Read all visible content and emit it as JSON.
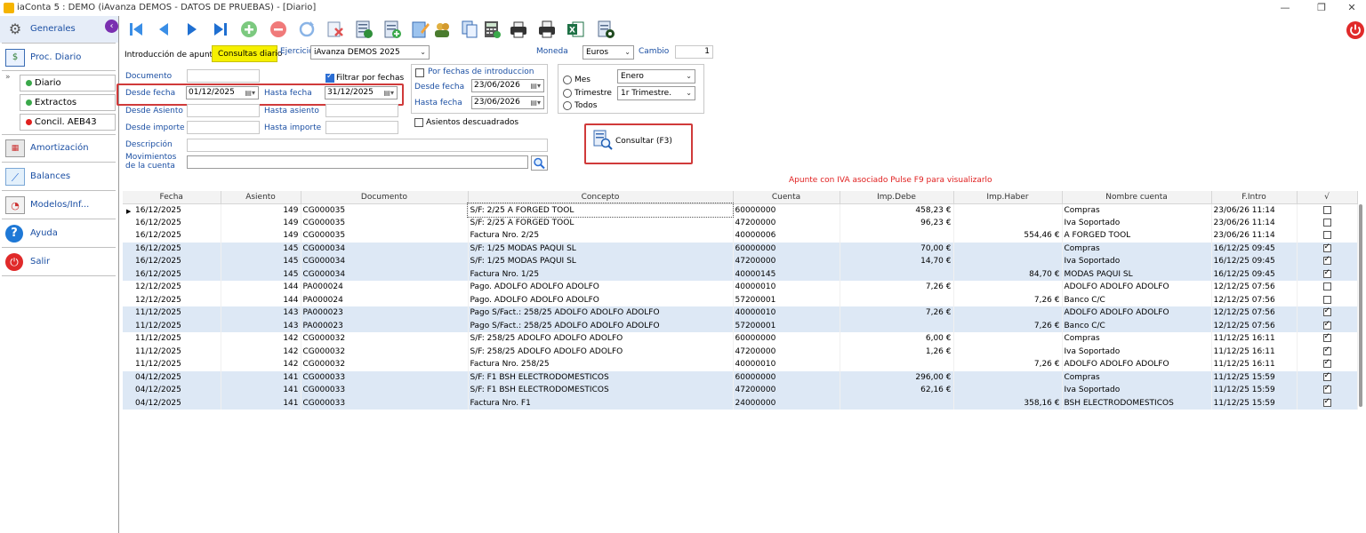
{
  "window": {
    "title": "iaConta 5 : DEMO (iAvanza DEMOS - DATOS DE PRUEBAS) - [Diario]"
  },
  "sidebar": {
    "items": [
      {
        "label": "Generales",
        "icon": "gear-icon"
      },
      {
        "label": "Proc. Diario",
        "icon": "journal-icon"
      },
      {
        "label": "Amortización",
        "icon": "calculator-icon"
      },
      {
        "label": "Balances",
        "icon": "chart-icon"
      },
      {
        "label": "Modelos/Inf...",
        "icon": "report-icon"
      },
      {
        "label": "Ayuda",
        "icon": "help-icon"
      },
      {
        "label": "Salir",
        "icon": "power-icon"
      }
    ],
    "subitems": [
      {
        "label": "Diario",
        "color": "#3aa84a"
      },
      {
        "label": "Extractos",
        "color": "#3aa84a"
      },
      {
        "label": "Concil. AEB43",
        "color": "#e0201e"
      }
    ]
  },
  "tabs": {
    "tab1": "Introducción de apuntes",
    "tab2": "Consultas diario"
  },
  "filters": {
    "ejercicio_label": "Ejercicio",
    "ejercicio_value": "iAvanza DEMOS 2025",
    "moneda_label": "Moneda",
    "moneda_value": "Euros",
    "cambio_label": "Cambio",
    "cambio_value": "1",
    "documento_label": "Documento",
    "desde_fecha_label": "Desde fecha",
    "desde_fecha_value": "01/12/2025",
    "hasta_fecha_label": "Hasta fecha",
    "hasta_fecha_value": "31/12/2025",
    "filtrar_label": "Filtrar por fechas",
    "desde_asiento_label": "Desde Asiento",
    "hasta_asiento_label": "Hasta asiento",
    "desde_importe_label": "Desde importe",
    "hasta_importe_label": "Hasta importe",
    "descripcion_label": "Descripción",
    "movimientos_label1": "Movimientos",
    "movimientos_label2": "de la cuenta",
    "por_fechas_label": "Por fechas de introduccion",
    "intro_desde_label": "Desde fecha",
    "intro_desde_value": "23/06/2026",
    "intro_hasta_label": "Hasta fecha",
    "intro_hasta_value": "23/06/2026",
    "descuadrados_label": "Asientos descuadrados",
    "mes_label": "Mes",
    "mes_value": "Enero",
    "trimestre_label": "Trimestre",
    "trimestre_value": "1r Trimestre.",
    "todos_label": "Todos",
    "consultar_label": "Consultar (F3)"
  },
  "notice": "Apunte con IVA asociado Pulse F9 para visualizarlo",
  "table": {
    "headers": [
      "Fecha",
      "Asiento",
      "Documento",
      "Concepto",
      "Cuenta",
      "Imp.Debe",
      "Imp.Haber",
      "Nombre cuenta",
      "F.Intro",
      "√"
    ],
    "rows": [
      {
        "fecha": "16/12/2025",
        "asiento": "149",
        "documento": "CG000035",
        "concepto": "S/F: 2/25 A FORGED TOOL",
        "cuenta": "60000000",
        "debe": "458,23 €",
        "haber": "",
        "nombre": "Compras",
        "fintro": "23/06/26 11:14",
        "checked": false
      },
      {
        "fecha": "16/12/2025",
        "asiento": "149",
        "documento": "CG000035",
        "concepto": "S/F: 2/25 A FORGED TOOL",
        "cuenta": "47200000",
        "debe": "96,23 €",
        "haber": "",
        "nombre": "Iva Soportado",
        "fintro": "23/06/26 11:14",
        "checked": false
      },
      {
        "fecha": "16/12/2025",
        "asiento": "149",
        "documento": "CG000035",
        "concepto": "Factura Nro. 2/25",
        "cuenta": "40000006",
        "debe": "",
        "haber": "554,46 €",
        "nombre": "A FORGED TOOL",
        "fintro": "23/06/26 11:14",
        "checked": false
      },
      {
        "fecha": "16/12/2025",
        "asiento": "145",
        "documento": "CG000034",
        "concepto": "S/F: 1/25 MODAS PAQUI SL",
        "cuenta": "60000000",
        "debe": "70,00 €",
        "haber": "",
        "nombre": "Compras",
        "fintro": "16/12/25 09:45",
        "checked": true
      },
      {
        "fecha": "16/12/2025",
        "asiento": "145",
        "documento": "CG000034",
        "concepto": "S/F: 1/25 MODAS PAQUI SL",
        "cuenta": "47200000",
        "debe": "14,70 €",
        "haber": "",
        "nombre": "Iva Soportado",
        "fintro": "16/12/25 09:45",
        "checked": true
      },
      {
        "fecha": "16/12/2025",
        "asiento": "145",
        "documento": "CG000034",
        "concepto": "Factura Nro. 1/25",
        "cuenta": "40000145",
        "debe": "",
        "haber": "84,70 €",
        "nombre": "MODAS PAQUI SL",
        "fintro": "16/12/25 09:45",
        "checked": true
      },
      {
        "fecha": "12/12/2025",
        "asiento": "144",
        "documento": "PA000024",
        "concepto": "Pago. ADOLFO ADOLFO ADOLFO",
        "cuenta": "40000010",
        "debe": "7,26 €",
        "haber": "",
        "nombre": "ADOLFO ADOLFO ADOLFO",
        "fintro": "12/12/25 07:56",
        "checked": false
      },
      {
        "fecha": "12/12/2025",
        "asiento": "144",
        "documento": "PA000024",
        "concepto": "Pago. ADOLFO ADOLFO ADOLFO",
        "cuenta": "57200001",
        "debe": "",
        "haber": "7,26 €",
        "nombre": "Banco C/C",
        "fintro": "12/12/25 07:56",
        "checked": false
      },
      {
        "fecha": "11/12/2025",
        "asiento": "143",
        "documento": "PA000023",
        "concepto": "Pago S/Fact.: 258/25 ADOLFO ADOLFO ADOLFO",
        "cuenta": "40000010",
        "debe": "7,26 €",
        "haber": "",
        "nombre": "ADOLFO ADOLFO ADOLFO",
        "fintro": "12/12/25 07:56",
        "checked": true
      },
      {
        "fecha": "11/12/2025",
        "asiento": "143",
        "documento": "PA000023",
        "concepto": "Pago S/Fact.: 258/25 ADOLFO ADOLFO ADOLFO",
        "cuenta": "57200001",
        "debe": "",
        "haber": "7,26 €",
        "nombre": "Banco C/C",
        "fintro": "12/12/25 07:56",
        "checked": true
      },
      {
        "fecha": "11/12/2025",
        "asiento": "142",
        "documento": "CG000032",
        "concepto": "S/F: 258/25 ADOLFO ADOLFO ADOLFO",
        "cuenta": "60000000",
        "debe": "6,00 €",
        "haber": "",
        "nombre": "Compras",
        "fintro": "11/12/25 16:11",
        "checked": true
      },
      {
        "fecha": "11/12/2025",
        "asiento": "142",
        "documento": "CG000032",
        "concepto": "S/F: 258/25 ADOLFO ADOLFO ADOLFO",
        "cuenta": "47200000",
        "debe": "1,26 €",
        "haber": "",
        "nombre": "Iva Soportado",
        "fintro": "11/12/25 16:11",
        "checked": true
      },
      {
        "fecha": "11/12/2025",
        "asiento": "142",
        "documento": "CG000032",
        "concepto": "Factura Nro. 258/25",
        "cuenta": "40000010",
        "debe": "",
        "haber": "7,26 €",
        "nombre": "ADOLFO ADOLFO ADOLFO",
        "fintro": "11/12/25 16:11",
        "checked": true
      },
      {
        "fecha": "04/12/2025",
        "asiento": "141",
        "documento": "CG000033",
        "concepto": "S/F: F1 BSH ELECTRODOMESTICOS",
        "cuenta": "60000000",
        "debe": "296,00 €",
        "haber": "",
        "nombre": "Compras",
        "fintro": "11/12/25 15:59",
        "checked": true
      },
      {
        "fecha": "04/12/2025",
        "asiento": "141",
        "documento": "CG000033",
        "concepto": "S/F: F1 BSH ELECTRODOMESTICOS",
        "cuenta": "47200000",
        "debe": "62,16 €",
        "haber": "",
        "nombre": "Iva Soportado",
        "fintro": "11/12/25 15:59",
        "checked": true
      },
      {
        "fecha": "04/12/2025",
        "asiento": "141",
        "documento": "CG000033",
        "concepto": "Factura Nro. F1",
        "cuenta": "24000000",
        "debe": "",
        "haber": "358,16 €",
        "nombre": "BSH ELECTRODOMESTICOS",
        "fintro": "11/12/25 15:59",
        "checked": true
      }
    ],
    "shaded": [
      false,
      false,
      false,
      true,
      true,
      true,
      false,
      false,
      true,
      true,
      false,
      false,
      false,
      true,
      true,
      true
    ]
  }
}
